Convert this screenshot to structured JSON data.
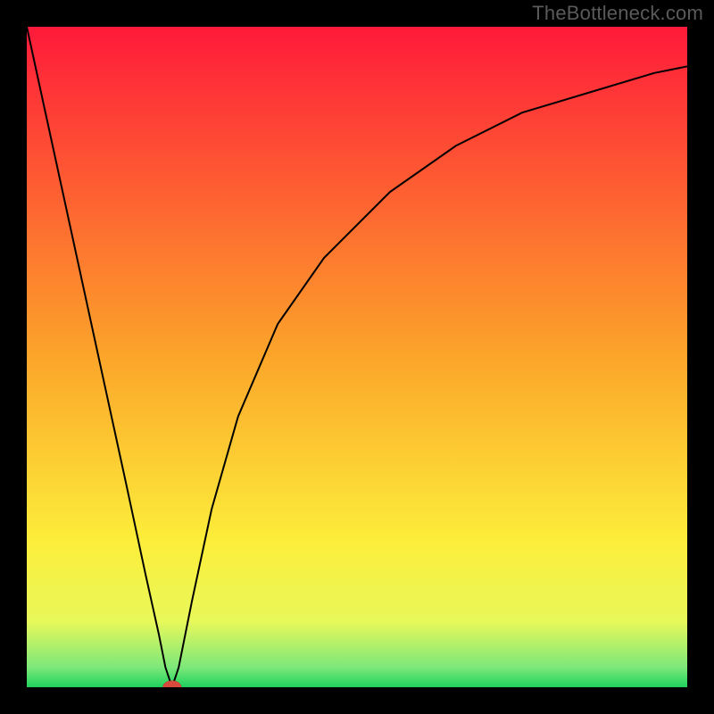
{
  "watermark": "TheBottleneck.com",
  "chart_data": {
    "type": "line",
    "title": "",
    "xlabel": "",
    "ylabel": "",
    "xlim": [
      0,
      100
    ],
    "ylim": [
      0,
      100
    ],
    "grid": false,
    "legend": false,
    "background_gradient": {
      "direction": "vertical",
      "stops": [
        {
          "pos": 0.0,
          "color": "#ff1a3a"
        },
        {
          "pos": 0.5,
          "color": "#fca52a"
        },
        {
          "pos": 0.78,
          "color": "#fcee3a"
        },
        {
          "pos": 0.9,
          "color": "#e8f85a"
        },
        {
          "pos": 0.97,
          "color": "#7de87a"
        },
        {
          "pos": 1.0,
          "color": "#1fd15c"
        }
      ]
    },
    "series": [
      {
        "name": "bottleneck-curve",
        "color": "#000000",
        "stroke_width": 2,
        "x": [
          0,
          5,
          10,
          15,
          18,
          20,
          21,
          22,
          23,
          25,
          28,
          32,
          38,
          45,
          55,
          65,
          75,
          85,
          95,
          100
        ],
        "y": [
          100,
          77,
          54,
          31,
          17,
          8,
          3,
          0,
          3,
          13,
          27,
          41,
          55,
          65,
          75,
          82,
          87,
          90,
          93,
          94
        ]
      }
    ],
    "marker": {
      "name": "optimal-point",
      "x": 22,
      "y": 0,
      "rx": 1.4,
      "ry": 1.0,
      "fill": "#d84a3c",
      "stroke": "#9c2e22"
    }
  }
}
